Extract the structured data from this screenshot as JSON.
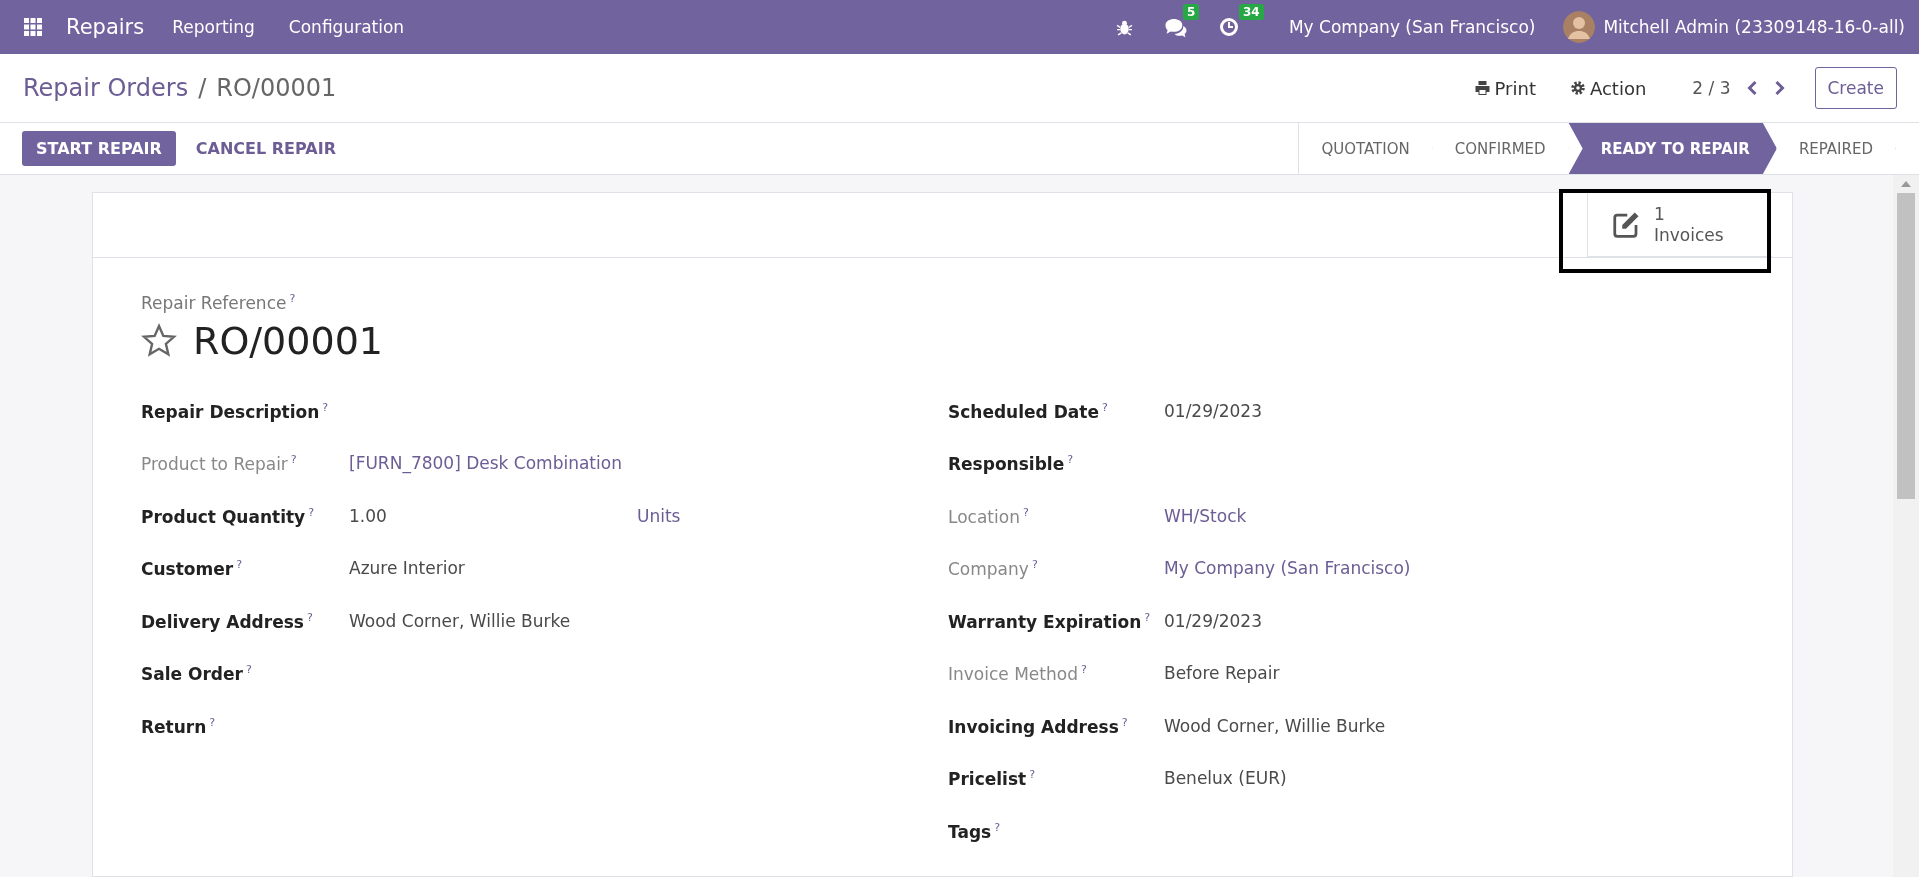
{
  "navbar": {
    "app": "Repairs",
    "menus": [
      "Reporting",
      "Configuration"
    ],
    "messages_badge": "5",
    "activities_badge": "34",
    "company": "My Company (San Francisco)",
    "user": "Mitchell Admin (23309148-16-0-all)"
  },
  "breadcrumb": {
    "parent": "Repair Orders",
    "separator": "/",
    "current": "RO/00001"
  },
  "toolbar": {
    "print": "Print",
    "action": "Action",
    "pager": "2 / 3",
    "create": "Create"
  },
  "buttons": [
    {
      "label": "START REPAIR",
      "primary": true
    },
    {
      "label": "CANCEL REPAIR",
      "primary": false
    }
  ],
  "stages": [
    {
      "label": "QUOTATION",
      "selected": false
    },
    {
      "label": "CONFIRMED",
      "selected": false
    },
    {
      "label": "READY TO REPAIR",
      "selected": true
    },
    {
      "label": "REPAIRED",
      "selected": false
    }
  ],
  "smart_button": {
    "count": "1",
    "label": "Invoices",
    "highlighted": true
  },
  "reference": {
    "label": "Repair Reference",
    "help": "?",
    "title": "RO/00001",
    "starred": false
  },
  "left_fields": [
    {
      "label": "Repair Description",
      "help": "?",
      "readonly": false
    },
    {
      "label": "Product to Repair",
      "help": "?",
      "readonly": true,
      "value": "[FURN_7800] Desk Combination",
      "link": true
    },
    {
      "label": "Product Quantity",
      "help": "?",
      "readonly": false,
      "value": "1.00",
      "link": false,
      "unit": "Units"
    },
    {
      "label": "Customer",
      "help": "?",
      "readonly": false,
      "value": "Azure Interior",
      "link": false
    },
    {
      "label": "Delivery Address",
      "help": "?",
      "readonly": false,
      "value": "Wood Corner, Willie Burke",
      "link": false
    },
    {
      "label": "Sale Order",
      "help": "?",
      "readonly": false
    },
    {
      "label": "Return",
      "help": "?",
      "readonly": false
    }
  ],
  "right_fields": [
    {
      "label": "Scheduled Date",
      "help": "?",
      "readonly": false,
      "value": "01/29/2023",
      "link": false
    },
    {
      "label": "Responsible",
      "help": "?",
      "readonly": false
    },
    {
      "label": "Location",
      "help": "?",
      "readonly": true,
      "value": "WH/Stock",
      "link": true
    },
    {
      "label": "Company",
      "help": "?",
      "readonly": true,
      "value": "My Company (San Francisco)",
      "link": true
    },
    {
      "label": "Warranty Expiration",
      "help": "?",
      "readonly": false,
      "value": "01/29/2023",
      "link": false
    },
    {
      "label": "Invoice Method",
      "help": "?",
      "readonly": true,
      "value": "Before Repair",
      "link": false
    },
    {
      "label": "Invoicing Address",
      "help": "?",
      "readonly": false,
      "value": "Wood Corner, Willie Burke",
      "link": false
    },
    {
      "label": "Pricelist",
      "help": "?",
      "readonly": false,
      "value": "Benelux (EUR)",
      "link": false
    },
    {
      "label": "Tags",
      "help": "?",
      "readonly": false
    }
  ]
}
